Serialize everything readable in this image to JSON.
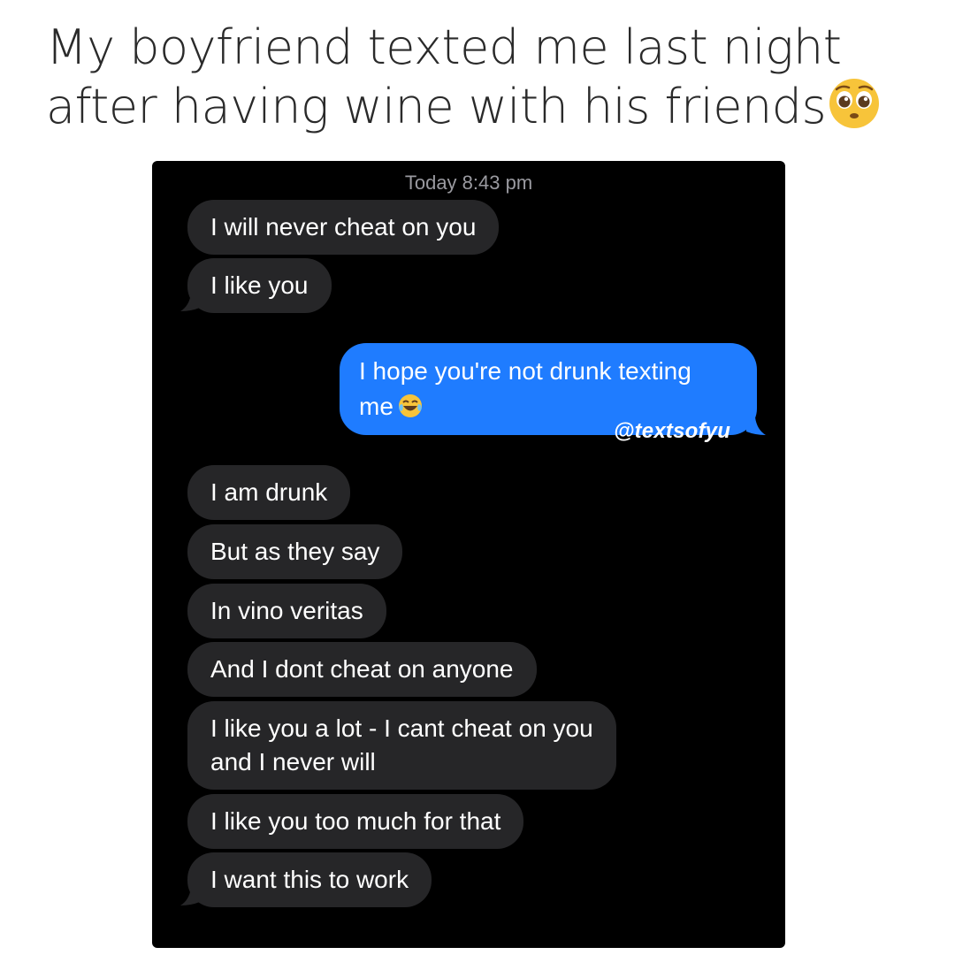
{
  "caption": {
    "text": "My boyfriend texted me last night after having wine with his friends",
    "emoji_icon": "pleading-face-icon"
  },
  "conversation": {
    "timestamp": "Today 8:43 pm",
    "messages": [
      {
        "from": "them",
        "text": "I will never cheat on you"
      },
      {
        "from": "them",
        "text": "I like you"
      },
      {
        "from": "me",
        "text_line1": "I hope you're not drunk texting",
        "text_line2": "me",
        "emoji_icon": "tears-of-joy-icon"
      },
      {
        "from": "them",
        "text": "I am drunk"
      },
      {
        "from": "them",
        "text": "But as they say"
      },
      {
        "from": "them",
        "text": "In vino veritas"
      },
      {
        "from": "them",
        "text": "And I dont cheat on anyone"
      },
      {
        "from": "them",
        "text_line1": "I like you a lot - I cant cheat on you",
        "text_line2": "and I never will"
      },
      {
        "from": "them",
        "text": "I like you too much for that"
      },
      {
        "from": "them",
        "text": "I want this to work"
      }
    ],
    "watermark": "@textsofyu"
  },
  "colors": {
    "sent_bubble": "#1f7cff",
    "received_bubble": "#262628",
    "background": "#000000",
    "timestamp": "#9a9aa0"
  }
}
